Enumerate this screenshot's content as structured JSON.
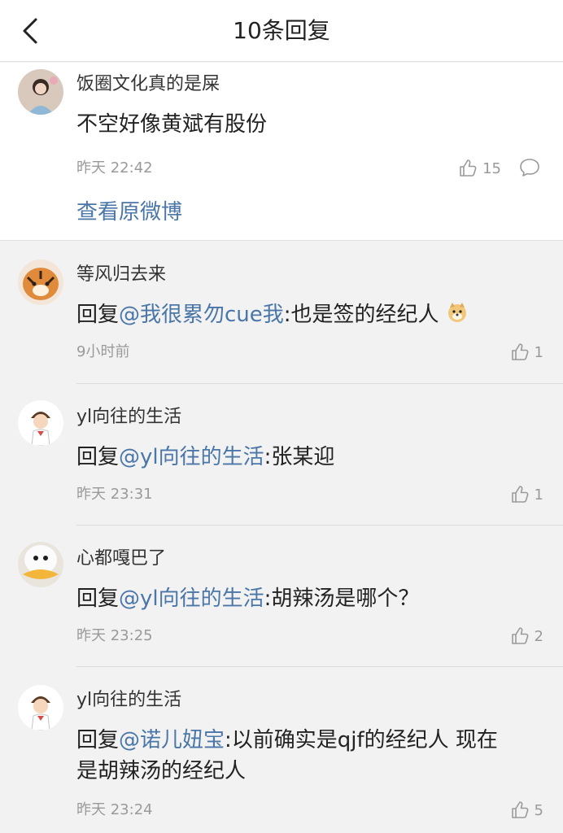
{
  "header": {
    "title": "10条回复"
  },
  "main_comment": {
    "user": "饭圈文化真的是屎",
    "text": "不空好像黄斌有股份",
    "time": "昨天 22:42",
    "likes": "15",
    "view_original": "查看原微博"
  },
  "replies": [
    {
      "user": "等风归去来",
      "prefix": "回复",
      "mention": "@我很累勿cue我",
      "text": ":也是签的经纪人",
      "time": "9小时前",
      "likes": "1"
    },
    {
      "user": "yl向往的生活",
      "prefix": "回复",
      "mention": "@yl向往的生活",
      "text": ":张某迎",
      "time": "昨天 23:31",
      "likes": "1"
    },
    {
      "user": "心都嘎巴了",
      "prefix": "回复",
      "mention": "@yl向往的生活",
      "text": ":胡辣汤是哪个？",
      "time": "昨天 23:25",
      "likes": "2"
    },
    {
      "user": "yl向往的生活",
      "prefix": "回复",
      "mention": "@诺儿妞宝",
      "text": ":以前确实是qjf的经纪人 现在",
      "text2": "是胡辣汤的经纪人",
      "time": "昨天 23:24",
      "likes": "5"
    }
  ]
}
